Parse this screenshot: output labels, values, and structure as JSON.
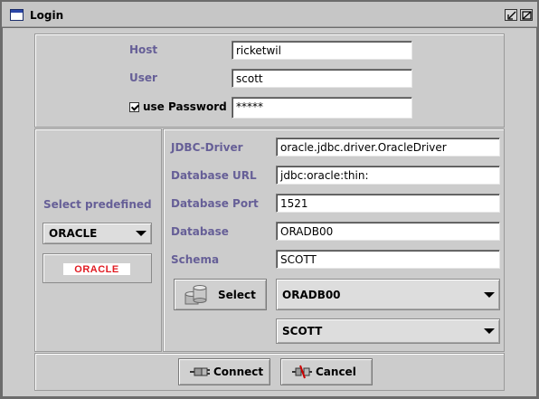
{
  "window": {
    "title": "Login"
  },
  "connection": {
    "host_label": "Host",
    "host_value": "ricketwil",
    "user_label": "User",
    "user_value": "scott",
    "use_password_label": "use Password",
    "use_password_checked": true,
    "password_value": "*****"
  },
  "predefined": {
    "label": "Select predefined",
    "selected": "ORACLE",
    "logo_text": "ORACLE"
  },
  "details": {
    "jdbc_driver_label": "JDBC-Driver",
    "jdbc_driver_value": "oracle.jdbc.driver.OracleDriver",
    "database_url_label": "Database URL",
    "database_url_value": "jdbc:oracle:thin:",
    "database_port_label": "Database Port",
    "database_port_value": "1521",
    "database_label": "Database",
    "database_value": "ORADB00",
    "schema_label": "Schema",
    "schema_value": "SCOTT",
    "select_button_label": "Select",
    "database_combo_selected": "ORADB00",
    "schema_combo_selected": "SCOTT"
  },
  "footer": {
    "connect_label": "Connect",
    "cancel_label": "Cancel"
  },
  "icons": {
    "window": "window-icon",
    "minimize": "minimize-icon",
    "maximize": "maximize-icon",
    "select": "database-icon",
    "connect": "plug-icon",
    "cancel": "unplug-icon"
  },
  "colors": {
    "label_purple": "#665f97",
    "background": "#cccccc",
    "oracle_red": "#e11b22"
  }
}
